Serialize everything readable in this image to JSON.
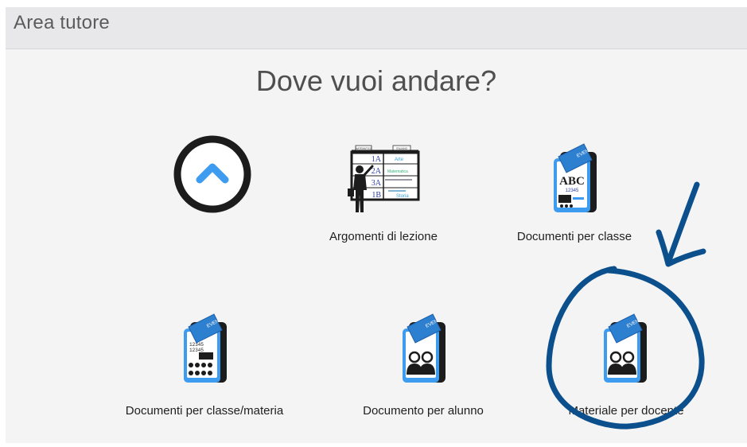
{
  "header": {
    "title": "Area tutore"
  },
  "main": {
    "heading": "Dove vuoi andare?",
    "tiles": [
      {
        "label": "",
        "icon": "chevron-up-circle-icon"
      },
      {
        "label": "Argomenti di lezione",
        "icon": "teacher-board-icon",
        "board": {
          "headers": [
            "MATEMATICA",
            "ITALIANO"
          ],
          "rows": [
            "1A",
            "2A",
            "3A",
            "1B"
          ],
          "subjects": [
            "Arte",
            "Matematica",
            "Storia"
          ]
        }
      },
      {
        "label": "Documenti per classe",
        "icon": "class-documents-icon",
        "card_letters": "ABC",
        "card_numbers": "12345",
        "tab_text": "EVEN"
      },
      {
        "label": "Documenti per classe/materia",
        "icon": "class-subject-documents-icon",
        "card_numbers": "12345",
        "tab_text": "EVEN"
      },
      {
        "label": "Documento per alunno",
        "icon": "student-document-icon",
        "tab_text": "EVEN"
      },
      {
        "label": "Materiale per docente",
        "icon": "teacher-material-icon",
        "tab_text": "EVEN"
      }
    ]
  },
  "colors": {
    "accent": "#3d9bf0",
    "icon_dark": "#1c1c1c",
    "annotation": "#0b4f8c"
  }
}
